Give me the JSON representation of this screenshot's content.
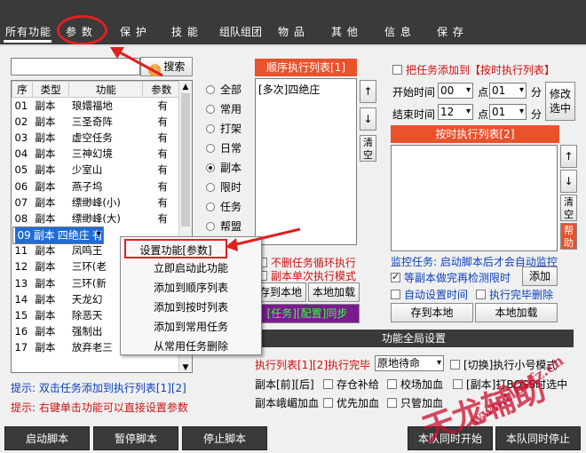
{
  "tabs": [
    "所有功能",
    "参 数",
    "保 护",
    "技 能",
    "组队组团",
    "物 品",
    "其 他",
    "信 息",
    "保 存"
  ],
  "search": {
    "value": "",
    "button": "搜索"
  },
  "grid": {
    "headers": [
      "序",
      "类型",
      "功能",
      "参数"
    ],
    "rows": [
      [
        "01",
        "副本",
        "琅嬛福地",
        "有"
      ],
      [
        "02",
        "副本",
        "三圣奇阵",
        "有"
      ],
      [
        "03",
        "副本",
        "虚空任务",
        "有"
      ],
      [
        "04",
        "副本",
        "三神幻境",
        "有"
      ],
      [
        "05",
        "副本",
        "少室山",
        "有"
      ],
      [
        "06",
        "副本",
        "燕子坞",
        "有"
      ],
      [
        "07",
        "副本",
        "缥缈峰(小)",
        "有"
      ],
      [
        "08",
        "副本",
        "缥缈峰(大)",
        "有"
      ],
      [
        "09",
        "副本",
        "四绝庄",
        "有"
      ],
      [
        "10",
        "副本",
        "杀 星",
        ""
      ],
      [
        "11",
        "副本",
        "凤鸣王",
        ""
      ],
      [
        "12",
        "副本",
        "三环(老",
        ""
      ],
      [
        "13",
        "副本",
        "三环(新",
        ""
      ],
      [
        "14",
        "副本",
        "天龙幻",
        ""
      ],
      [
        "15",
        "副本",
        "除恶天",
        ""
      ],
      [
        "16",
        "副本",
        "强制出",
        ""
      ],
      [
        "17",
        "副本",
        "放弃老三",
        ""
      ]
    ]
  },
  "radios": [
    "全部",
    "常用",
    "打架",
    "日常",
    "副本",
    "限时",
    "任务",
    "帮盟"
  ],
  "seq": {
    "header": "顺序执行列表[1]",
    "items": [
      "[多次]四绝庄"
    ],
    "up": "↑",
    "down": "↓",
    "clear": "清空"
  },
  "timed": {
    "add_check": "把任务添加到【按时执行列表】",
    "start_label": "开始时间",
    "start_h": "00",
    "start_m": "01",
    "end_label": "结束时间",
    "end_h": "12",
    "end_m": "01",
    "point": "点",
    "minute": "分",
    "modify": "修改选中",
    "header": "按时执行列表[2]",
    "up": "↑",
    "down": "↓",
    "clear": "清空",
    "help": "帮助"
  },
  "monitor": {
    "text": "监控任务: 启动脚本后才会自动监控",
    "limit_check": "等副本做完再检测限时",
    "add": "添加",
    "auto_time": "自动设置时间",
    "delete_done": "执行完毕删除",
    "save_local": "存到本地",
    "load_local": "本地加载"
  },
  "left_opts": {
    "no_loop": "不删任务循环执行",
    "single": "副本单次执行模式",
    "save_local": "存到本地",
    "load_local": "本地加载",
    "sync": "[任务][配置]同步"
  },
  "global": {
    "title": "功能全局设置",
    "done_label": "执行列表[1][2]执行完毕",
    "done_value": "原地待命",
    "small_alt": "[切换]执行小号模式",
    "dungeon_front_back": "副本[前][后]",
    "store_supply": "存仓补给",
    "school_boost": "校场加血",
    "boss_option": "[副本]打BOSS时选中",
    "emei_boost": "副本峨嵋加血",
    "prio_boost": "优先加血",
    "only_manage": "只管加血"
  },
  "tips": [
    "提示: 双击任务添加到执行列表[1][2]",
    "提示: 右键单击功能可以直接设置参数"
  ],
  "context_menu": [
    "设置功能[参数]",
    "立即启动此功能",
    "添加到顺序列表",
    "添加到按时列表",
    "添加到常用任务",
    "从常用任务删除"
  ],
  "bottom_buttons": [
    "启动脚本",
    "暂停脚本",
    "停止脚本",
    "本队同时开始",
    "本队同时停止"
  ],
  "watermark": {
    "brand": "天龙辅助",
    "url": "www.tlbbfz.cn"
  },
  "colors": {
    "accent": "#e8532c",
    "dark": "#3a3a3a",
    "select": "#1e6cd6",
    "annotation": "#e02020"
  }
}
